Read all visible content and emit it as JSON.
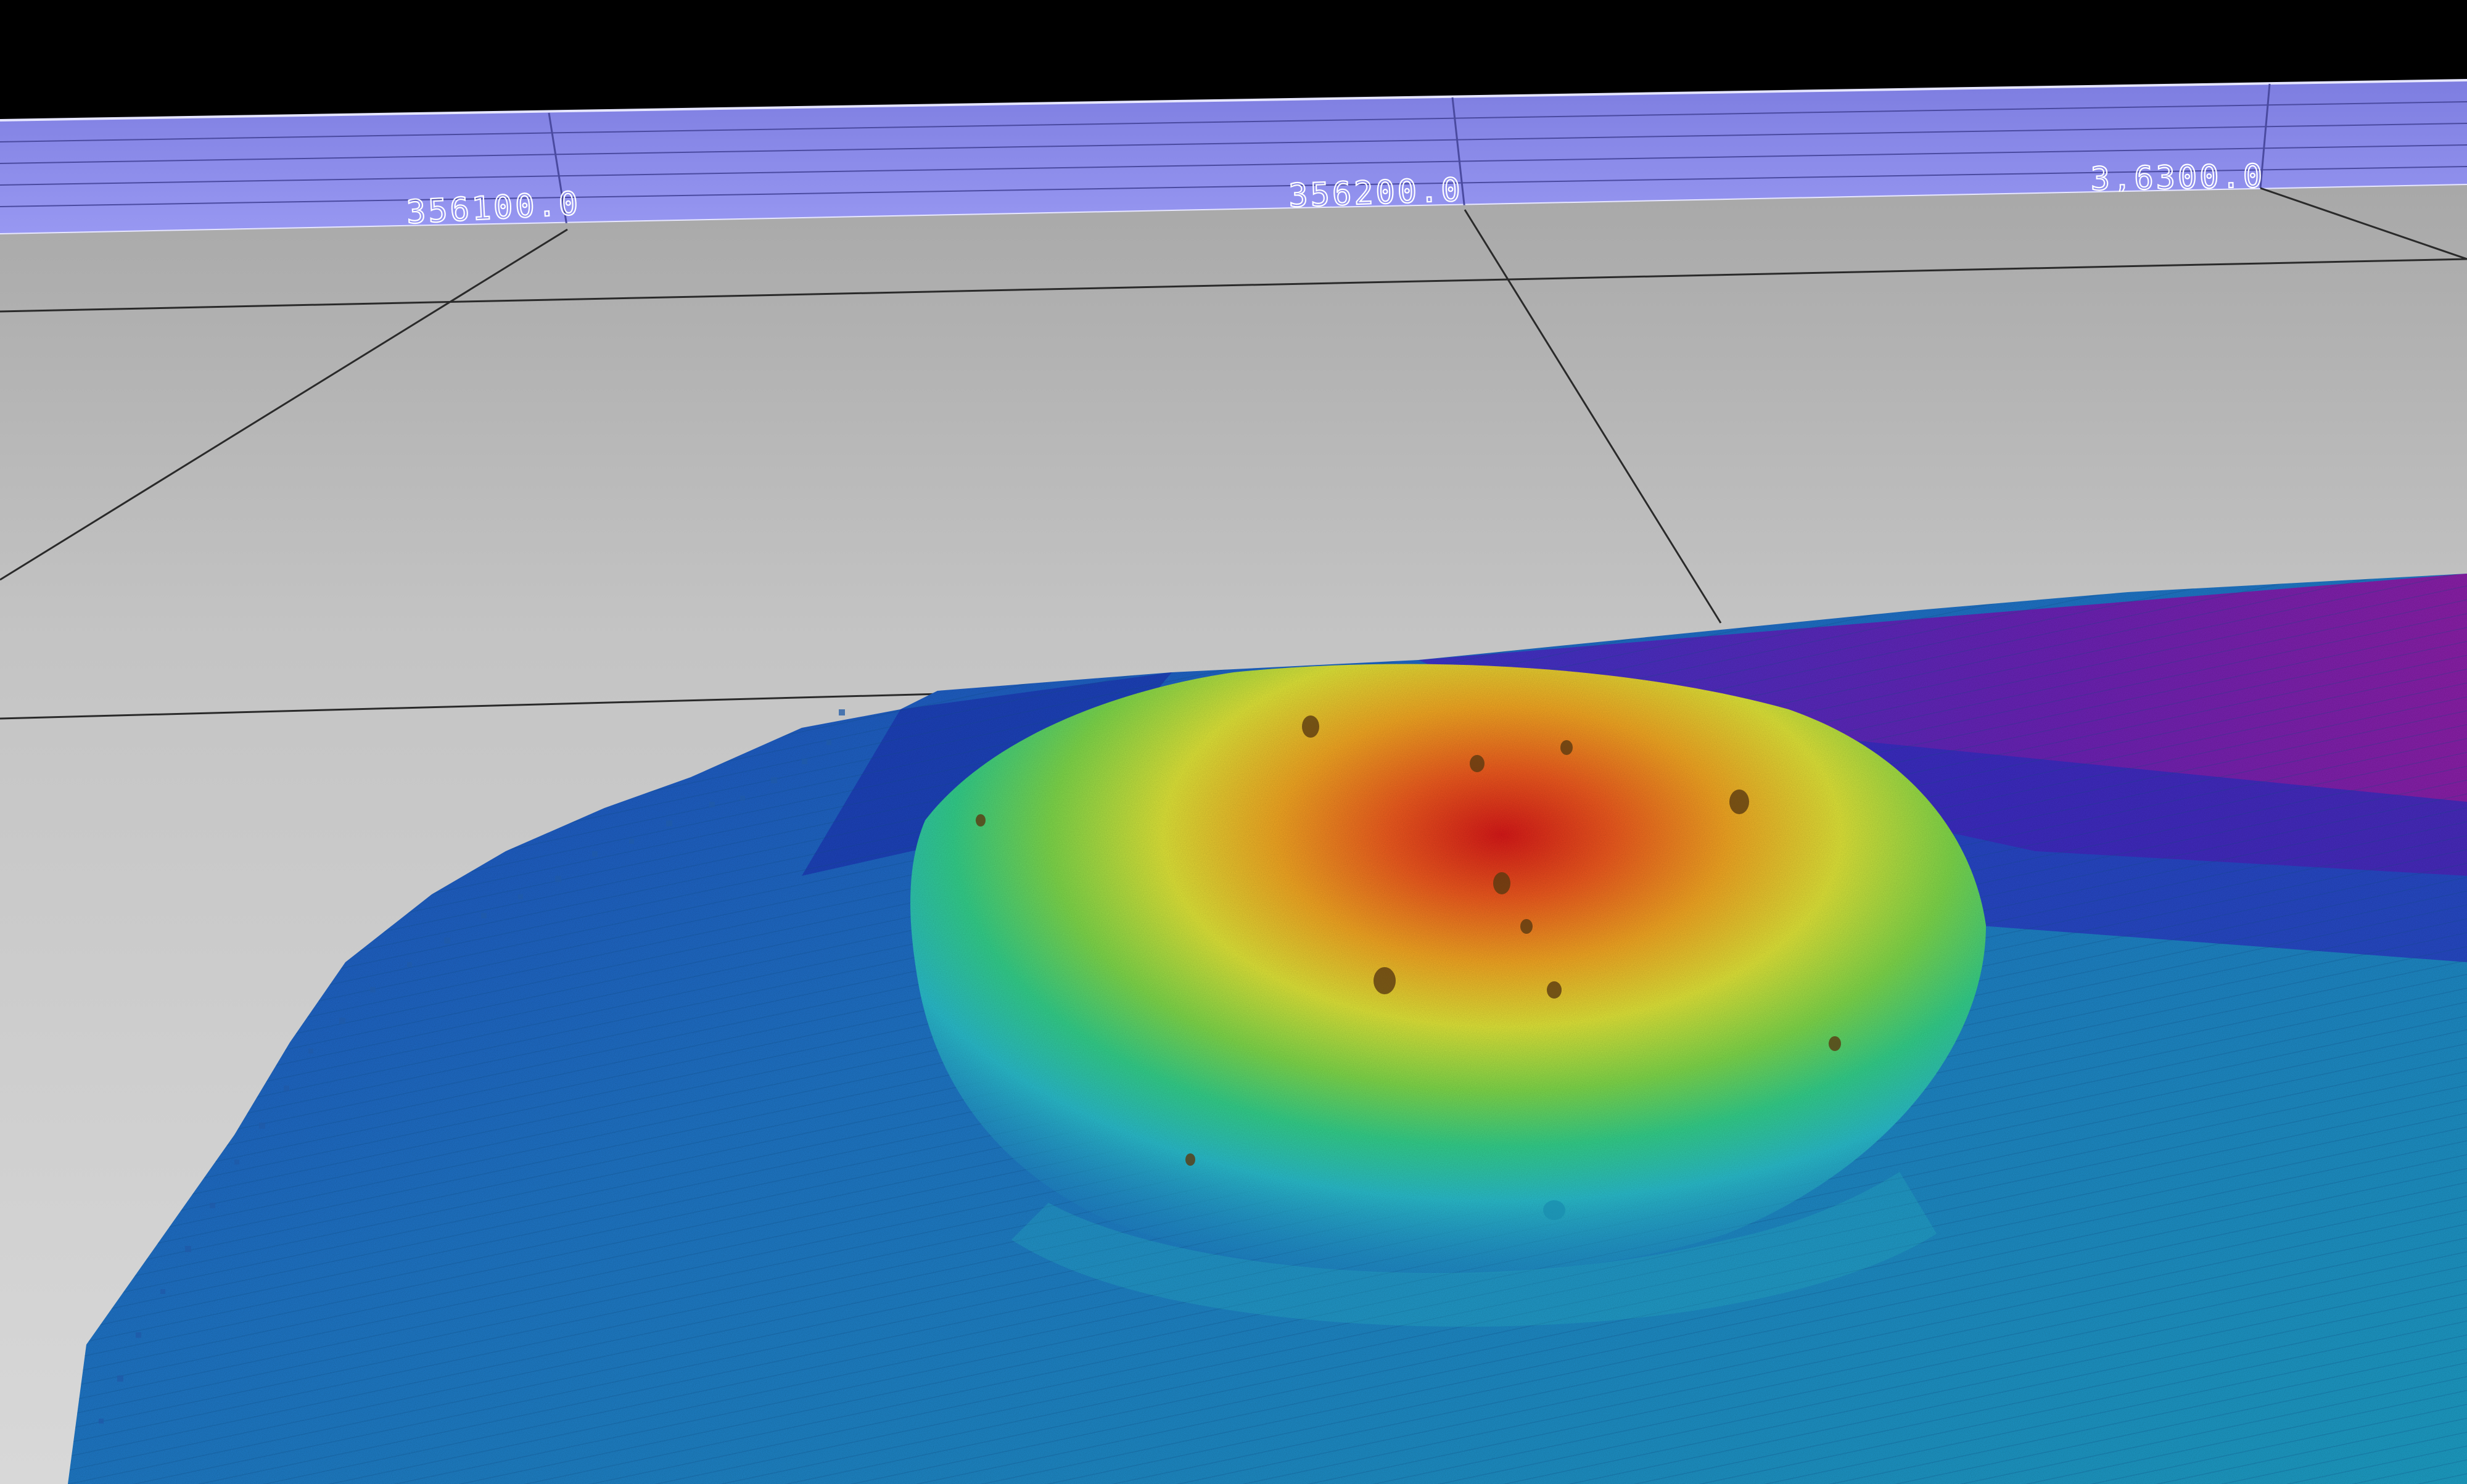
{
  "scene": {
    "axis_labels": [
      "356100.0",
      "356200.0",
      "3,6300.0"
    ],
    "colors": {
      "background": "#000000",
      "ruler_band": "#8a8aee",
      "ground_plane": "#c9c9c9",
      "grid_line": "#2a2a2a",
      "depth_ramp": [
        "#7a1fa8",
        "#2a2ad0",
        "#1f66c8",
        "#25b8c9",
        "#3fd46a",
        "#d8e33a",
        "#f0a020",
        "#d81818"
      ]
    }
  }
}
